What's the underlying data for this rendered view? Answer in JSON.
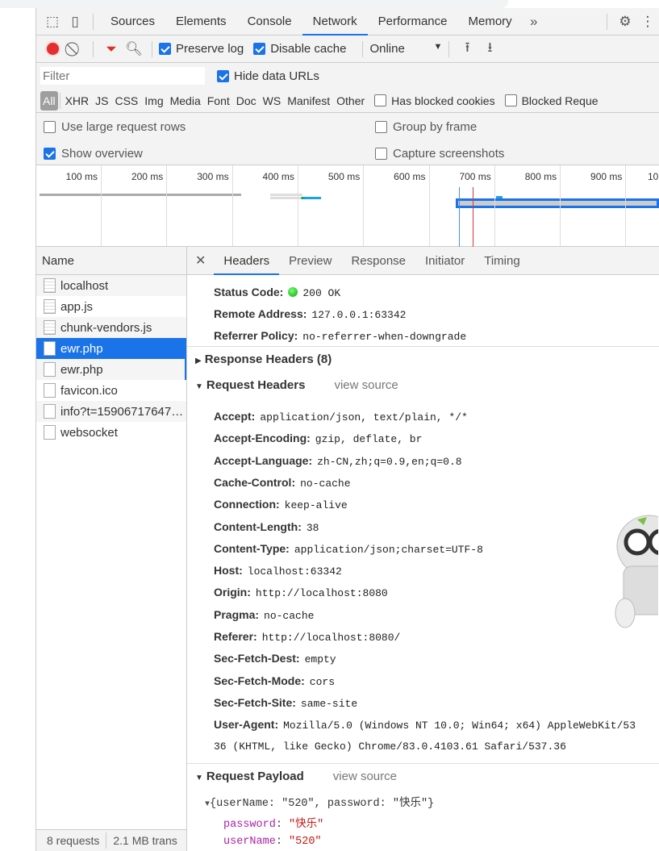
{
  "tabs": [
    "Sources",
    "Elements",
    "Console",
    "Network",
    "Performance",
    "Memory"
  ],
  "toolbar": {
    "preserve_log": "Preserve log",
    "disable_cache": "Disable cache",
    "throttle": "Online",
    "record_color": "#e32f2f",
    "filter_color": "#d93025"
  },
  "filter": {
    "placeholder": "Filter",
    "hide_data_urls": "Hide data URLs"
  },
  "types": [
    "All",
    "XHR",
    "JS",
    "CSS",
    "Img",
    "Media",
    "Font",
    "Doc",
    "WS",
    "Manifest",
    "Other"
  ],
  "blocked": {
    "cookies": "Has blocked cookies",
    "requests": "Blocked Reque"
  },
  "options": {
    "large_rows": "Use large request rows",
    "group_frame": "Group by frame",
    "show_overview": "Show overview",
    "capture": "Capture screenshots"
  },
  "overview": {
    "ticks": [
      "100 ms",
      "200 ms",
      "300 ms",
      "400 ms",
      "500 ms",
      "600 ms",
      "700 ms",
      "800 ms",
      "900 ms",
      "10"
    ]
  },
  "names": {
    "header": "Name",
    "items": [
      "localhost",
      "app.js",
      "chunk-vendors.js",
      "ewr.php",
      "ewr.php",
      "favicon.ico",
      "info?t=15906717647…",
      "websocket"
    ]
  },
  "footer": {
    "requests": "8 requests",
    "transferred": "2.1 MB trans"
  },
  "detail_tabs": [
    "Headers",
    "Preview",
    "Response",
    "Initiator",
    "Timing"
  ],
  "general": [
    {
      "k": "Status Code:",
      "v": "200 OK"
    },
    {
      "k": "Remote Address:",
      "v": "127.0.0.1:63342"
    },
    {
      "k": "Referrer Policy:",
      "v": "no-referrer-when-downgrade"
    }
  ],
  "response_headers": "Response Headers (8)",
  "request_headers": {
    "title": "Request Headers",
    "view_source": "view source",
    "items": [
      {
        "k": "Accept:",
        "v": "application/json, text/plain, */*"
      },
      {
        "k": "Accept-Encoding:",
        "v": "gzip, deflate, br"
      },
      {
        "k": "Accept-Language:",
        "v": "zh-CN,zh;q=0.9,en;q=0.8"
      },
      {
        "k": "Cache-Control:",
        "v": "no-cache"
      },
      {
        "k": "Connection:",
        "v": "keep-alive"
      },
      {
        "k": "Content-Length:",
        "v": "38"
      },
      {
        "k": "Content-Type:",
        "v": "application/json;charset=UTF-8"
      },
      {
        "k": "Host:",
        "v": "localhost:63342"
      },
      {
        "k": "Origin:",
        "v": "http://localhost:8080"
      },
      {
        "k": "Pragma:",
        "v": "no-cache"
      },
      {
        "k": "Referer:",
        "v": "http://localhost:8080/"
      },
      {
        "k": "Sec-Fetch-Dest:",
        "v": "empty"
      },
      {
        "k": "Sec-Fetch-Mode:",
        "v": "cors"
      },
      {
        "k": "Sec-Fetch-Site:",
        "v": "same-site"
      },
      {
        "k": "User-Agent:",
        "v": "Mozilla/5.0 (Windows NT 10.0; Win64; x64) AppleWebKit/53"
      }
    ],
    "ua_cont": "36 (KHTML, like Gecko) Chrome/83.0.4103.61 Safari/537.36"
  },
  "payload": {
    "title": "Request Payload",
    "view_source": "view source",
    "summary": "{userName: \"520\", password: \"快乐\"}",
    "fields": [
      {
        "k": "password",
        "v": "\"快乐\""
      },
      {
        "k": "userName",
        "v": "\"520\""
      }
    ]
  }
}
